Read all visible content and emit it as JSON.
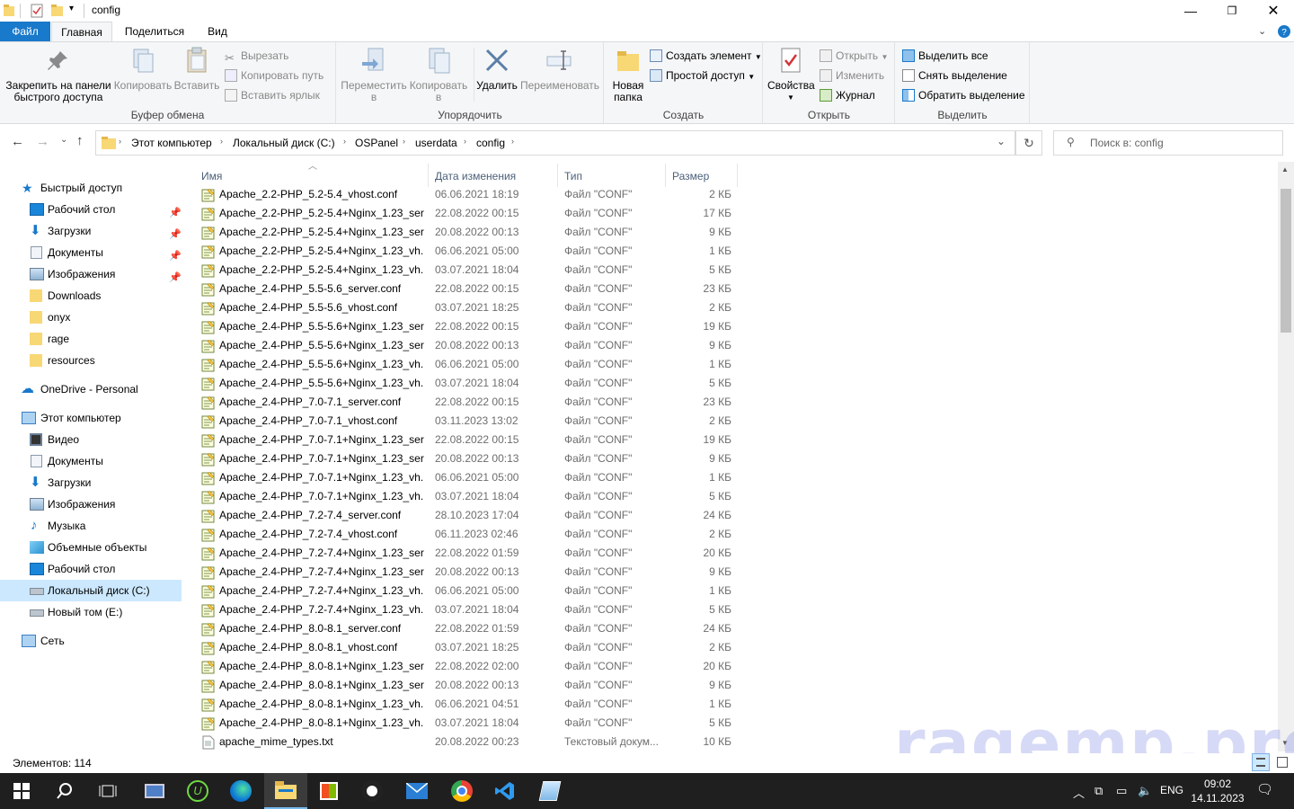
{
  "window": {
    "title": "config"
  },
  "tabs": [
    "Файл",
    "Главная",
    "Поделиться",
    "Вид"
  ],
  "ribbon": {
    "clipboard": {
      "pin": "Закрепить на панели быстрого доступа",
      "pin_l1": "Закрепить на панели",
      "pin_l2": "быстрого доступа",
      "copy": "Копировать",
      "paste": "Вставить",
      "cut": "Вырезать",
      "copy_path": "Копировать путь",
      "paste_shortcut": "Вставить ярлык",
      "group": "Буфер обмена"
    },
    "organize": {
      "move": "Переместить в",
      "move_l1": "Переместить",
      "move_l2": "в",
      "copy_to": "Копировать в",
      "copy_l1": "Копировать",
      "copy_l2": "в",
      "delete": "Удалить",
      "rename": "Переименовать",
      "group": "Упорядочить"
    },
    "new": {
      "new_folder_l1": "Новая",
      "new_folder_l2": "папка",
      "new_item": "Создать элемент",
      "easy_access": "Простой доступ",
      "group": "Создать"
    },
    "open": {
      "properties": "Свойства",
      "open": "Открыть",
      "edit": "Изменить",
      "history": "Журнал",
      "group": "Открыть"
    },
    "select": {
      "select_all": "Выделить все",
      "select_none": "Снять выделение",
      "invert": "Обратить выделение",
      "group": "Выделить"
    }
  },
  "address": {
    "crumbs": [
      "Этот компьютер",
      "Локальный диск (C:)",
      "OSPanel",
      "userdata",
      "config"
    ],
    "search_placeholder": "Поиск в: config"
  },
  "nav": {
    "quick_access": "Быстрый доступ",
    "quick_items": [
      "Рабочий стол",
      "Загрузки",
      "Документы",
      "Изображения",
      "Downloads",
      "onyx",
      "rage",
      "resources"
    ],
    "onedrive": "OneDrive - Personal",
    "this_pc": "Этот компьютер",
    "pc_items": [
      "Видео",
      "Документы",
      "Загрузки",
      "Изображения",
      "Музыка",
      "Объемные объекты",
      "Рабочий стол",
      "Локальный диск (C:)",
      "Новый том (E:)"
    ],
    "network": "Сеть"
  },
  "columns": {
    "name": "Имя",
    "date": "Дата изменения",
    "type": "Тип",
    "size": "Размер"
  },
  "files": [
    {
      "name": "Apache_2.2-PHP_5.2-5.4_vhost.conf",
      "date": "06.06.2021 18:19",
      "type": "Файл \"CONF\"",
      "size": "2 КБ"
    },
    {
      "name": "Apache_2.2-PHP_5.2-5.4+Nginx_1.23_ser...",
      "date": "22.08.2022 00:15",
      "type": "Файл \"CONF\"",
      "size": "17 КБ"
    },
    {
      "name": "Apache_2.2-PHP_5.2-5.4+Nginx_1.23_ser...",
      "date": "20.08.2022 00:13",
      "type": "Файл \"CONF\"",
      "size": "9 КБ"
    },
    {
      "name": "Apache_2.2-PHP_5.2-5.4+Nginx_1.23_vh...",
      "date": "06.06.2021 05:00",
      "type": "Файл \"CONF\"",
      "size": "1 КБ"
    },
    {
      "name": "Apache_2.2-PHP_5.2-5.4+Nginx_1.23_vh...",
      "date": "03.07.2021 18:04",
      "type": "Файл \"CONF\"",
      "size": "5 КБ"
    },
    {
      "name": "Apache_2.4-PHP_5.5-5.6_server.conf",
      "date": "22.08.2022 00:15",
      "type": "Файл \"CONF\"",
      "size": "23 КБ"
    },
    {
      "name": "Apache_2.4-PHP_5.5-5.6_vhost.conf",
      "date": "03.07.2021 18:25",
      "type": "Файл \"CONF\"",
      "size": "2 КБ"
    },
    {
      "name": "Apache_2.4-PHP_5.5-5.6+Nginx_1.23_ser...",
      "date": "22.08.2022 00:15",
      "type": "Файл \"CONF\"",
      "size": "19 КБ"
    },
    {
      "name": "Apache_2.4-PHP_5.5-5.6+Nginx_1.23_ser...",
      "date": "20.08.2022 00:13",
      "type": "Файл \"CONF\"",
      "size": "9 КБ"
    },
    {
      "name": "Apache_2.4-PHP_5.5-5.6+Nginx_1.23_vh...",
      "date": "06.06.2021 05:00",
      "type": "Файл \"CONF\"",
      "size": "1 КБ"
    },
    {
      "name": "Apache_2.4-PHP_5.5-5.6+Nginx_1.23_vh...",
      "date": "03.07.2021 18:04",
      "type": "Файл \"CONF\"",
      "size": "5 КБ"
    },
    {
      "name": "Apache_2.4-PHP_7.0-7.1_server.conf",
      "date": "22.08.2022 00:15",
      "type": "Файл \"CONF\"",
      "size": "23 КБ"
    },
    {
      "name": "Apache_2.4-PHP_7.0-7.1_vhost.conf",
      "date": "03.11.2023 13:02",
      "type": "Файл \"CONF\"",
      "size": "2 КБ"
    },
    {
      "name": "Apache_2.4-PHP_7.0-7.1+Nginx_1.23_ser...",
      "date": "22.08.2022 00:15",
      "type": "Файл \"CONF\"",
      "size": "19 КБ"
    },
    {
      "name": "Apache_2.4-PHP_7.0-7.1+Nginx_1.23_ser...",
      "date": "20.08.2022 00:13",
      "type": "Файл \"CONF\"",
      "size": "9 КБ"
    },
    {
      "name": "Apache_2.4-PHP_7.0-7.1+Nginx_1.23_vh...",
      "date": "06.06.2021 05:00",
      "type": "Файл \"CONF\"",
      "size": "1 КБ"
    },
    {
      "name": "Apache_2.4-PHP_7.0-7.1+Nginx_1.23_vh...",
      "date": "03.07.2021 18:04",
      "type": "Файл \"CONF\"",
      "size": "5 КБ"
    },
    {
      "name": "Apache_2.4-PHP_7.2-7.4_server.conf",
      "date": "28.10.2023 17:04",
      "type": "Файл \"CONF\"",
      "size": "24 КБ"
    },
    {
      "name": "Apache_2.4-PHP_7.2-7.4_vhost.conf",
      "date": "06.11.2023 02:46",
      "type": "Файл \"CONF\"",
      "size": "2 КБ"
    },
    {
      "name": "Apache_2.4-PHP_7.2-7.4+Nginx_1.23_ser...",
      "date": "22.08.2022 01:59",
      "type": "Файл \"CONF\"",
      "size": "20 КБ"
    },
    {
      "name": "Apache_2.4-PHP_7.2-7.4+Nginx_1.23_ser...",
      "date": "20.08.2022 00:13",
      "type": "Файл \"CONF\"",
      "size": "9 КБ"
    },
    {
      "name": "Apache_2.4-PHP_7.2-7.4+Nginx_1.23_vh...",
      "date": "06.06.2021 05:00",
      "type": "Файл \"CONF\"",
      "size": "1 КБ"
    },
    {
      "name": "Apache_2.4-PHP_7.2-7.4+Nginx_1.23_vh...",
      "date": "03.07.2021 18:04",
      "type": "Файл \"CONF\"",
      "size": "5 КБ"
    },
    {
      "name": "Apache_2.4-PHP_8.0-8.1_server.conf",
      "date": "22.08.2022 01:59",
      "type": "Файл \"CONF\"",
      "size": "24 КБ"
    },
    {
      "name": "Apache_2.4-PHP_8.0-8.1_vhost.conf",
      "date": "03.07.2021 18:25",
      "type": "Файл \"CONF\"",
      "size": "2 КБ"
    },
    {
      "name": "Apache_2.4-PHP_8.0-8.1+Nginx_1.23_ser...",
      "date": "22.08.2022 02:00",
      "type": "Файл \"CONF\"",
      "size": "20 КБ"
    },
    {
      "name": "Apache_2.4-PHP_8.0-8.1+Nginx_1.23_ser...",
      "date": "20.08.2022 00:13",
      "type": "Файл \"CONF\"",
      "size": "9 КБ"
    },
    {
      "name": "Apache_2.4-PHP_8.0-8.1+Nginx_1.23_vh...",
      "date": "06.06.2021 04:51",
      "type": "Файл \"CONF\"",
      "size": "1 КБ"
    },
    {
      "name": "Apache_2.4-PHP_8.0-8.1+Nginx_1.23_vh...",
      "date": "03.07.2021 18:04",
      "type": "Файл \"CONF\"",
      "size": "5 КБ"
    },
    {
      "name": "apache_mime_types.txt",
      "date": "20.08.2022 00:23",
      "type": "Текстовый докум...",
      "size": "10 КБ"
    }
  ],
  "status": {
    "count": "Элементов: 114"
  },
  "watermark": "ragemp.pro",
  "taskbar": {
    "lang": "ENG",
    "time": "09:02",
    "date": "14.11.2023"
  },
  "colors": {
    "accent": "#1979ca",
    "selection": "#cce8ff",
    "taskbar": "#1f1f1f"
  }
}
